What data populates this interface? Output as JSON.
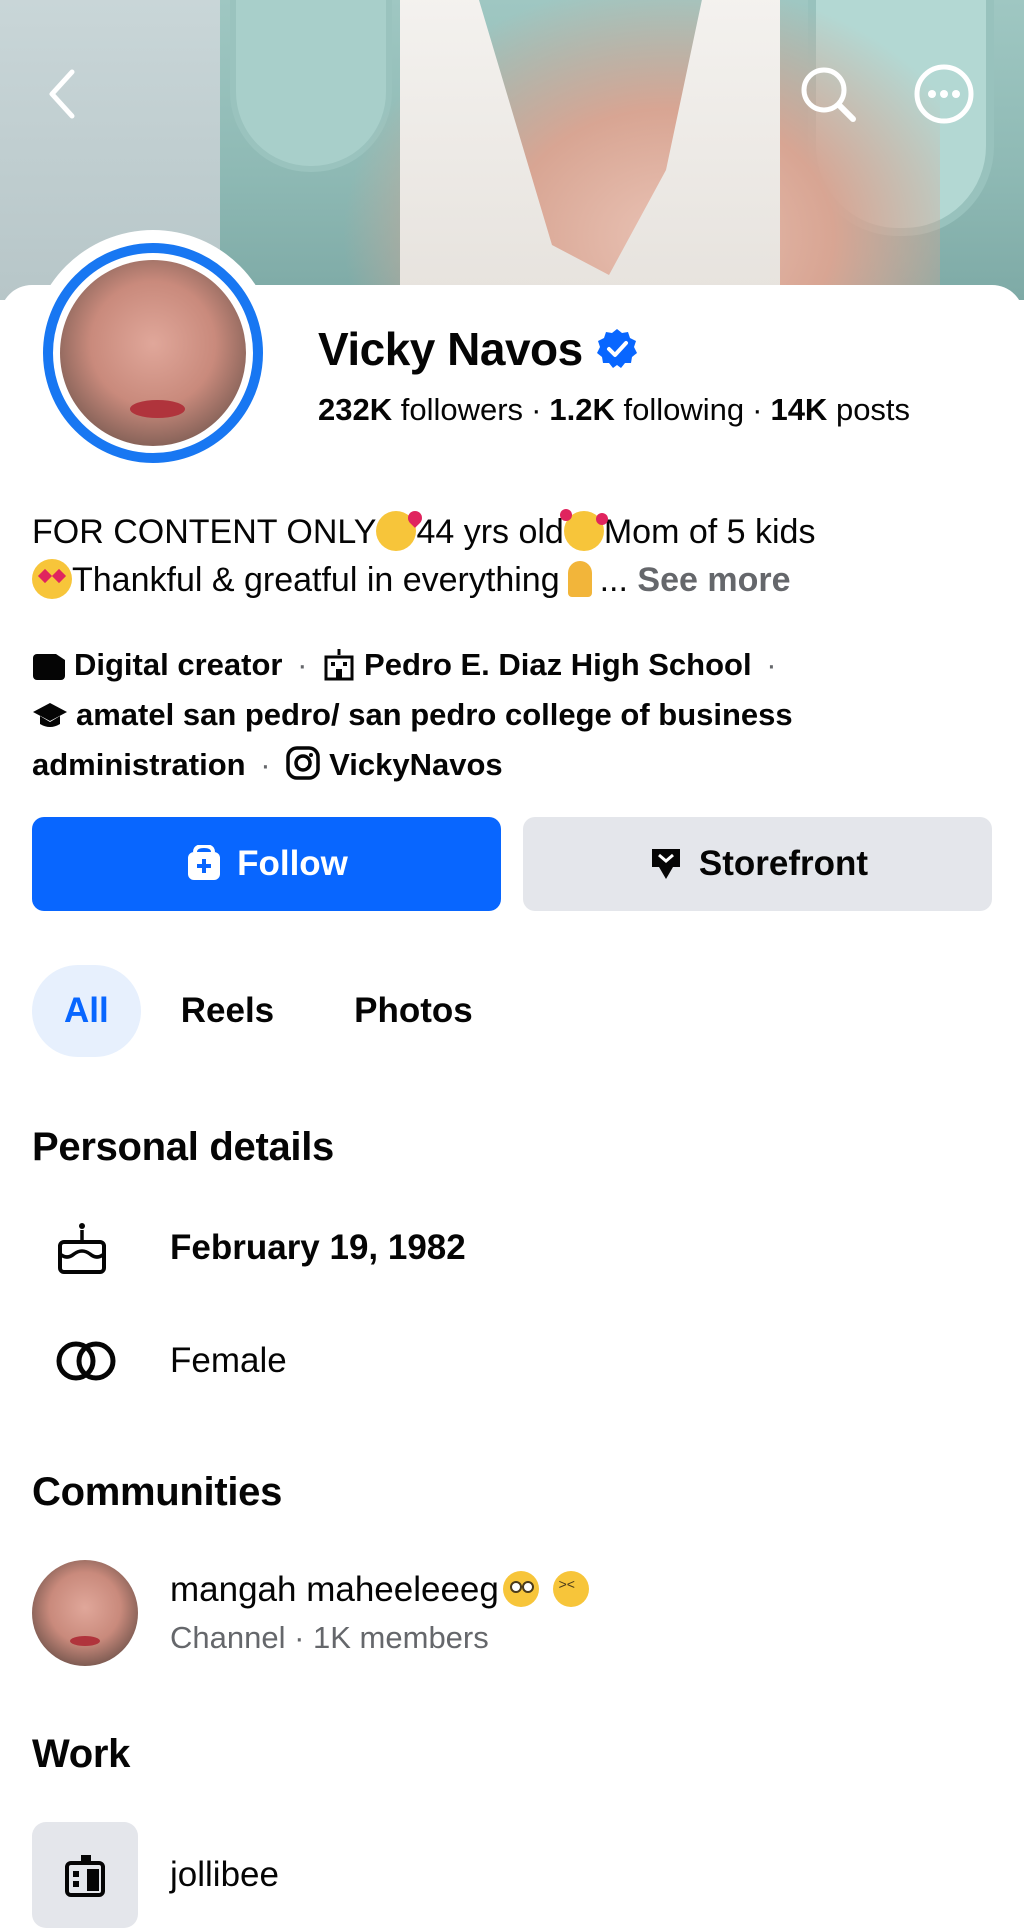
{
  "header": {
    "back_icon": "chevron-left-icon",
    "search_icon": "search-icon",
    "more_icon": "more-horizontal-icon"
  },
  "profile": {
    "name": "Vicky Navos",
    "verified": true,
    "followers_count": "232K",
    "followers_label": "followers",
    "following_count": "1.2K",
    "following_label": "following",
    "posts_count": "14K",
    "posts_label": "posts",
    "bio_line1_a": "FOR CONTENT ONLY",
    "bio_line1_b": "44 yrs old",
    "bio_line1_c": "Mom of 5 kids",
    "bio_line2_a": "Thankful & greatful in everything",
    "bio_ellipsis": "...",
    "see_more": "See more"
  },
  "intro": {
    "category": "Digital creator",
    "school": "Pedro E. Diaz High School",
    "college": "amatel san pedro/ san pedro college of business administration",
    "instagram": "VickyNavos",
    "separator": "·"
  },
  "actions": {
    "follow_label": "Follow",
    "storefront_label": "Storefront"
  },
  "tabs": [
    {
      "label": "All",
      "active": true
    },
    {
      "label": "Reels",
      "active": false
    },
    {
      "label": "Photos",
      "active": false
    }
  ],
  "personal_details": {
    "title": "Personal details",
    "birthday": "February 19, 1982",
    "gender": "Female"
  },
  "communities": {
    "title": "Communities",
    "items": [
      {
        "name": "mangah maheeleeeg",
        "subtitle": "Channel · 1K members"
      }
    ]
  },
  "work": {
    "title": "Work",
    "items": [
      {
        "name": "jollibee"
      }
    ]
  },
  "colors": {
    "brand_blue": "#0866ff",
    "ring_blue": "#1877f2",
    "secondary_text": "#65676b",
    "button_gray": "#e4e6eb",
    "tab_active_bg": "#e7f0fd"
  }
}
